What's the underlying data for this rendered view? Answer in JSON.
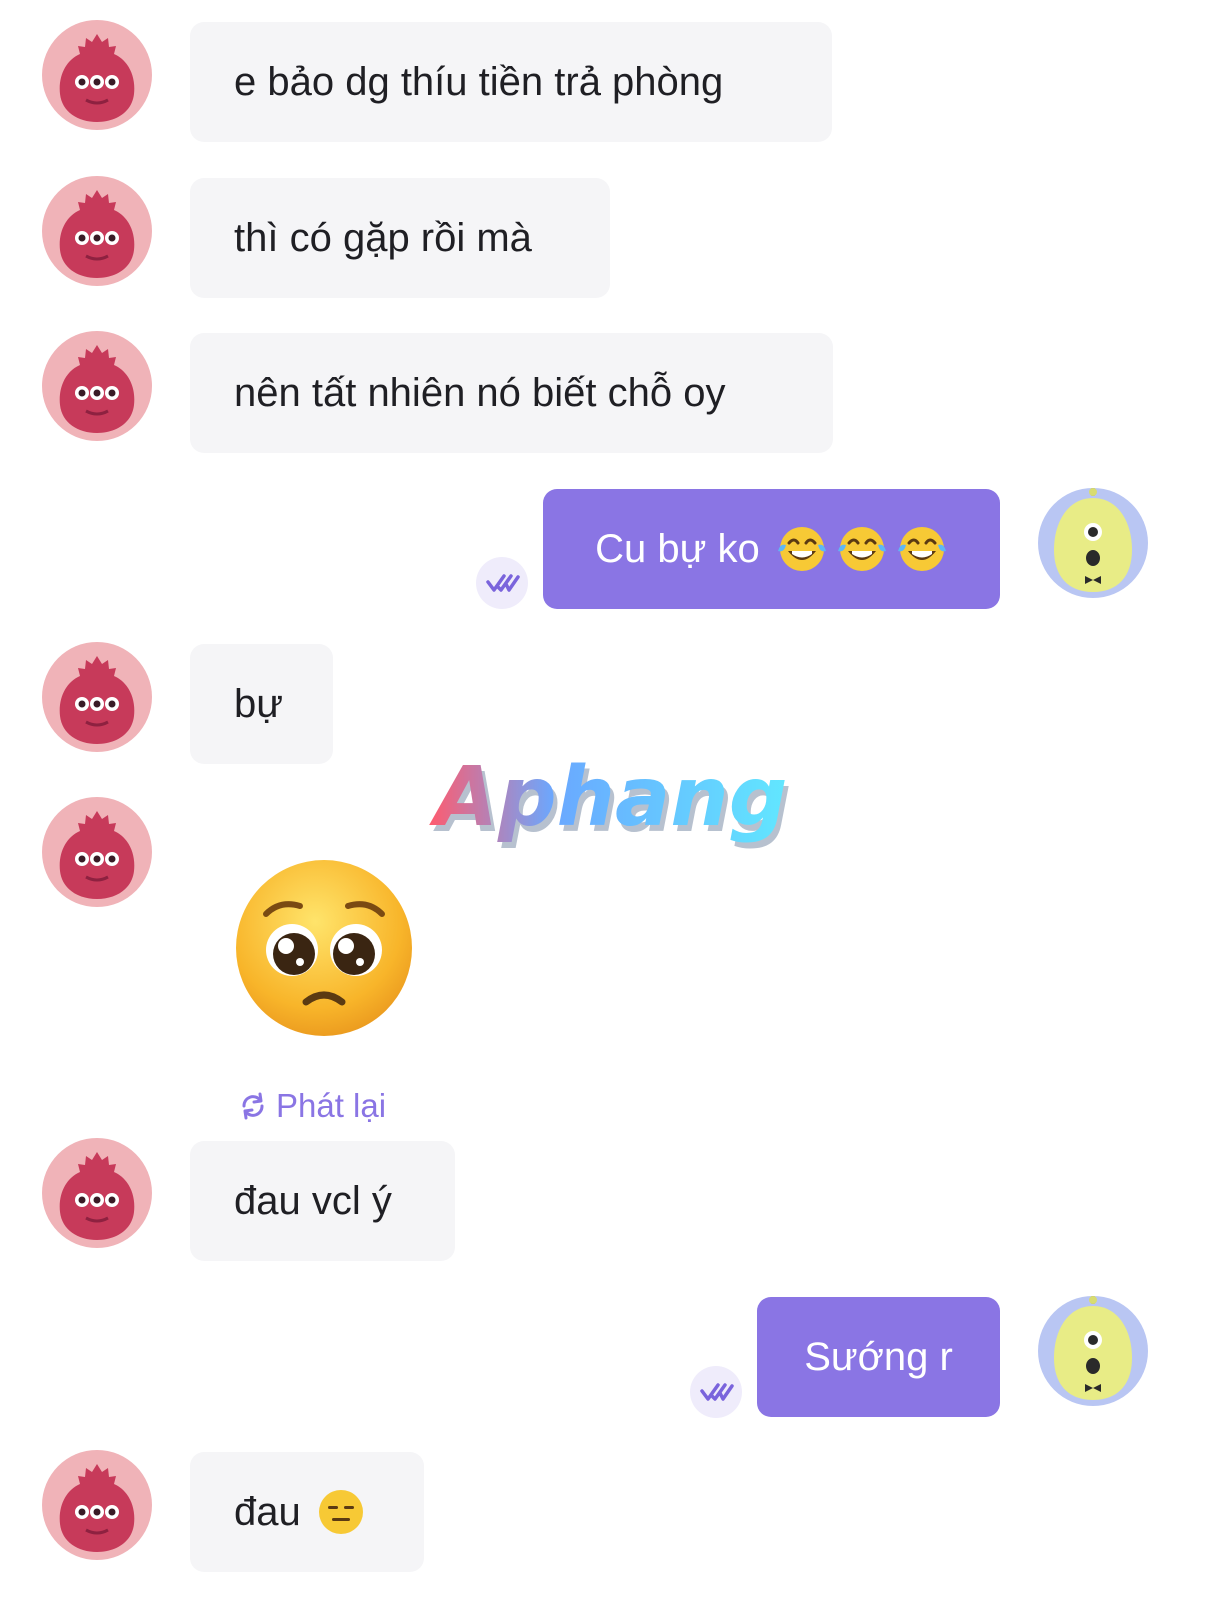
{
  "messages": [
    {
      "side": "received",
      "text": "e bảo dg thíu tiền trả phòng"
    },
    {
      "side": "received",
      "text": "thì có gặp rồi mà"
    },
    {
      "side": "received",
      "text": "nên tất nhiên nó biết chỗ oy"
    },
    {
      "side": "sent",
      "text": "Cu bự ko",
      "emojis": [
        "tears-of-joy-emoji",
        "tears-of-joy-emoji",
        "tears-of-joy-emoji"
      ]
    },
    {
      "side": "received",
      "text": "bự"
    },
    {
      "side": "received",
      "type": "sticker",
      "sticker": "pleading-face-emoji",
      "action_label": "Phát lại"
    },
    {
      "side": "received",
      "text": "đau vcl ý"
    },
    {
      "side": "sent",
      "text": "Sướng r"
    },
    {
      "side": "received",
      "text": "đau",
      "emojis": [
        "expressionless-face-emoji"
      ]
    }
  ],
  "watermark": {
    "text": "Aphang"
  },
  "icons": {
    "received_avatar": "red-monster-avatar",
    "sent_avatar": "yellow-alien-avatar",
    "read_receipt": "double-check-icon",
    "replay": "replay-icon"
  },
  "colors": {
    "sent_bubble": "#8a75e4",
    "received_bubble": "#f5f5f7",
    "accent": "#8a75e4",
    "received_avatar_bg": "#f0b3b8",
    "received_avatar_fg": "#c73a5a",
    "sent_avatar_bg": "#b9c6f3",
    "sent_avatar_fg": "#e8ec86"
  }
}
